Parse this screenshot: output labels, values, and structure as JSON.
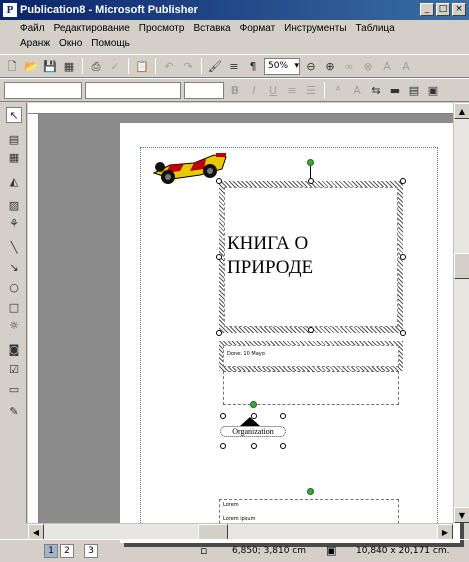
{
  "window": {
    "title": "Publication8 - Microsoft Publisher",
    "app_icon_letter": "P",
    "min_label": "_",
    "max_label": "□",
    "close_label": "×"
  },
  "menu": {
    "row1": [
      "Файл",
      "Редактирование",
      "Просмотр",
      "Вставка",
      "Формат",
      "Инструменты",
      "Таблица"
    ],
    "row2": [
      "Аранж",
      "Окно",
      "Помощь"
    ]
  },
  "toolbar": {
    "zoom_value": "50%"
  },
  "document": {
    "heading": "КНИГА О ПРИРОДЕ",
    "small_frame_text": "Done: 10 Mayo",
    "org_text": "Organization",
    "bottom_frame_text1": "Lorem",
    "bottom_frame_text2": "Lorem ipsum"
  },
  "status": {
    "pages": [
      "1",
      "2",
      "3"
    ],
    "position": "6,850; 3,810 cm",
    "size": "10,840 x 20,171 cm."
  }
}
